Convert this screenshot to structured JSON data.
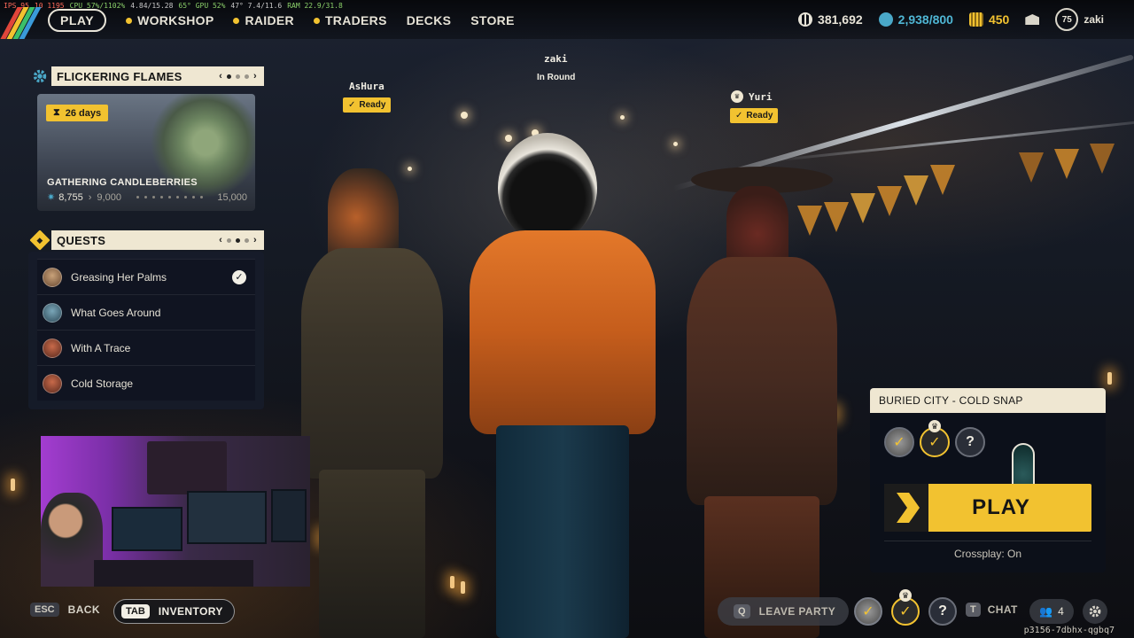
{
  "stats": {
    "fps": "IPS 95",
    "frametime": "10 1195",
    "cpu": "CPU 57%/1102%",
    "mem": "4.84/15.28",
    "gpu": "65° GPU 52%",
    "gpu2": "47° 7.4/11.6",
    "ram": "RAM 22.9/31.8"
  },
  "nav": {
    "play": "PLAY",
    "items": [
      "WORKSHOP",
      "RAIDER",
      "TRADERS",
      "DECKS",
      "STORE"
    ]
  },
  "currency": {
    "coins": "381,692",
    "tokens": "2,938/800",
    "premium": "450",
    "level": "75",
    "username": "zaki"
  },
  "event": {
    "title": "FLICKERING FLAMES",
    "days": "26 days",
    "name": "GATHERING CANDLEBERRIES",
    "current": "8,755",
    "milestone": "9,000",
    "goal": "15,000"
  },
  "quests": {
    "title": "QUESTS",
    "items": [
      {
        "label": "Greasing Her Palms",
        "completed": true
      },
      {
        "label": "What Goes Around",
        "completed": false
      },
      {
        "label": "With A Trace",
        "completed": false
      },
      {
        "label": "Cold Storage",
        "completed": false
      }
    ]
  },
  "players": {
    "left": {
      "name": "AsHura",
      "status": "Ready"
    },
    "center": {
      "name": "zaki",
      "status": "In Round"
    },
    "right": {
      "name": "Yuri",
      "status": "Ready"
    }
  },
  "match": {
    "map": "BURIED CITY - COLD SNAP",
    "slot3": "?",
    "play": "PLAY",
    "crossplay": "Crossplay: On"
  },
  "bottom": {
    "esc_key": "ESC",
    "back": "BACK",
    "tab_key": "TAB",
    "inventory": "INVENTORY",
    "q_key": "Q",
    "leave_party": "LEAVE PARTY",
    "slot3": "?",
    "t_key": "T",
    "chat": "CHAT",
    "party_count": "4",
    "session": "p3156-7dbhx-qgbq7"
  },
  "colors": {
    "accent": "#f2c230",
    "panel_header": "#efe7d2"
  }
}
